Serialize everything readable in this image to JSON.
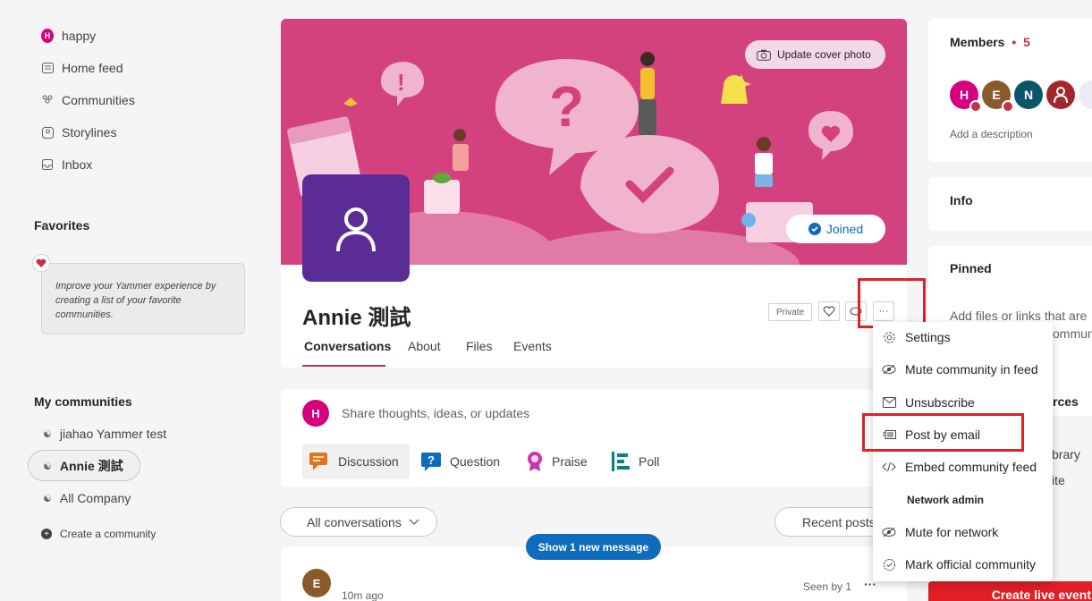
{
  "sidebar": {
    "items": [
      {
        "label": "happy",
        "icon": "h-avatar"
      },
      {
        "label": "Home feed",
        "icon": "home-feed-icon"
      },
      {
        "label": "Communities",
        "icon": "communities-icon"
      },
      {
        "label": "Storylines",
        "icon": "storylines-icon"
      },
      {
        "label": "Inbox",
        "icon": "inbox-icon"
      }
    ],
    "avatar_letter": "H",
    "favorites_title": "Favorites",
    "favorites_hint": "Improve your Yammer experience by creating a list of your favorite communities.",
    "my_communities_title": "My communities",
    "communities": [
      {
        "label": "jiahao Yammer test"
      },
      {
        "label": "Annie 測試"
      },
      {
        "label": "All Company"
      }
    ],
    "create_label": "Create a community"
  },
  "community": {
    "update_cover": "Update cover photo",
    "joined": "Joined",
    "name": "Annie 測試",
    "private": "Private",
    "more": "···",
    "tabs": [
      "Conversations",
      "About",
      "Files",
      "Events"
    ]
  },
  "composer": {
    "avatar_letter": "H",
    "placeholder": "Share thoughts, ideas, or updates",
    "types": [
      "Discussion",
      "Question",
      "Praise",
      "Poll"
    ]
  },
  "feed": {
    "filter": "All conversations",
    "sort": "Recent posts",
    "new_message": "Show 1 new message",
    "post_avatar": "E",
    "post_time": "10m ago",
    "seen_by": "Seen by 1",
    "post_more": "···"
  },
  "menu": {
    "items": [
      "Settings",
      "Mute community in feed",
      "Unsubscribe",
      "Post by email",
      "Embed community feed"
    ],
    "section": "Network admin",
    "admin_items": [
      "Mute for network",
      "Mark official community"
    ]
  },
  "right": {
    "members_title": "Members",
    "members_dot": "•",
    "members_count": "5",
    "member_letters": [
      "H",
      "E",
      "N"
    ],
    "add_description": "Add a description",
    "info_title": "Info",
    "pinned_title": "Pinned",
    "pinned_text": "Add files or links that are",
    "pinned_text2": "ommun",
    "resources_fragment": "rces",
    "link_fragment1": "brary",
    "link_fragment2": "ite",
    "live_event": "Create live event"
  },
  "colors": {
    "brand": "#0f6cbd",
    "cover": "#d3427f",
    "community_avatar": "#5b2b96",
    "highlight": "#e01f26"
  }
}
